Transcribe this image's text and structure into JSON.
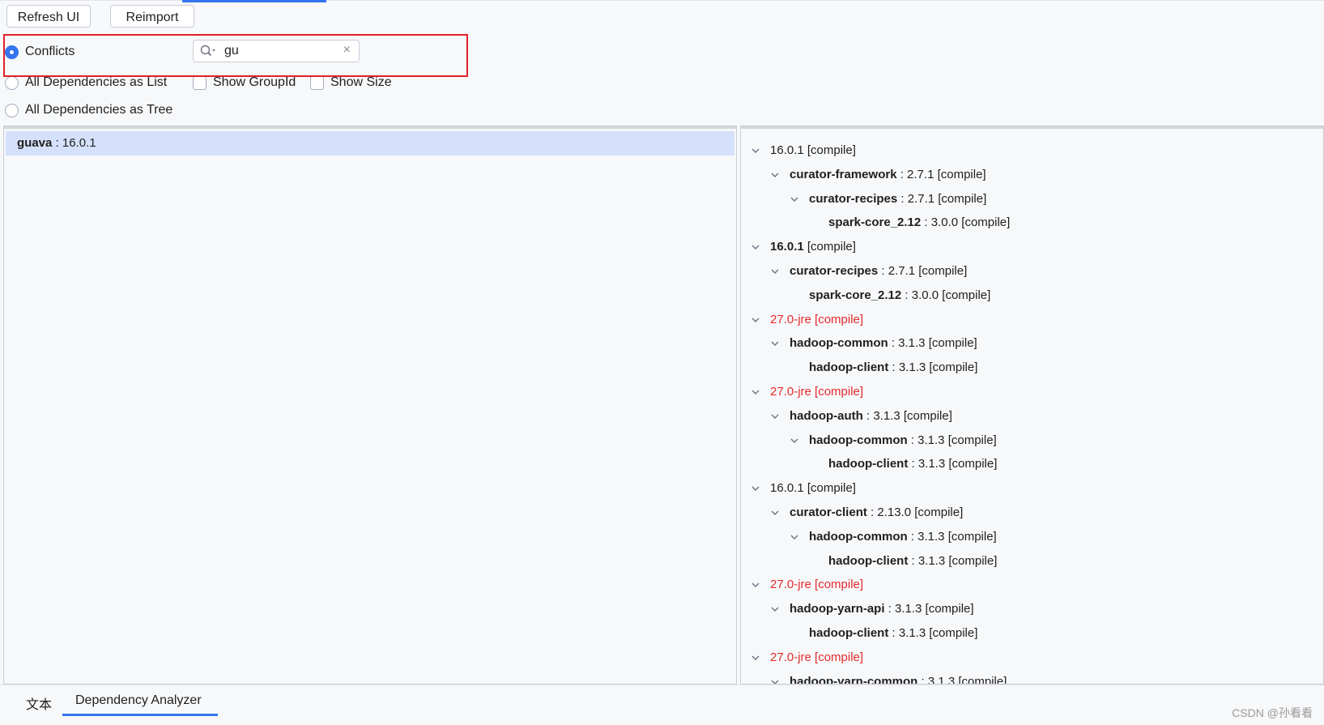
{
  "toolbar": {
    "refresh_label": "Refresh UI",
    "reimport_label": "Reimport"
  },
  "view_options": {
    "conflicts_label": "Conflicts",
    "list_label": "All Dependencies as List",
    "tree_label": "All Dependencies as Tree",
    "show_groupid_label": "Show GroupId",
    "show_size_label": "Show Size",
    "selected": "Conflicts"
  },
  "search": {
    "value": "gu",
    "clear_glyph": "×",
    "icon": "search-icon"
  },
  "left_list": {
    "items": [
      {
        "name": "guava",
        "version": " : 16.0.1",
        "selected": true
      }
    ]
  },
  "tree": {
    "rows": [
      {
        "level": 0,
        "expanded": true,
        "bold": "",
        "text": "16.0.1 [compile]",
        "conflict": false
      },
      {
        "level": 1,
        "expanded": true,
        "bold": "curator-framework",
        "text": " : 2.7.1 [compile]",
        "conflict": false
      },
      {
        "level": 2,
        "expanded": true,
        "bold": "curator-recipes",
        "text": " : 2.7.1 [compile]",
        "conflict": false
      },
      {
        "level": 3,
        "expanded": false,
        "bold": "spark-core_2.12",
        "text": " : 3.0.0 [compile]",
        "conflict": false
      },
      {
        "level": 0,
        "expanded": true,
        "bold": "16.0.1",
        "text": " [compile]",
        "conflict": false
      },
      {
        "level": 1,
        "expanded": true,
        "bold": "curator-recipes",
        "text": " : 2.7.1 [compile]",
        "conflict": false
      },
      {
        "level": 2,
        "expanded": false,
        "bold": "spark-core_2.12",
        "text": " : 3.0.0 [compile]",
        "conflict": false
      },
      {
        "level": 0,
        "expanded": true,
        "bold": "",
        "text": "27.0-jre [compile]",
        "conflict": true
      },
      {
        "level": 1,
        "expanded": true,
        "bold": "hadoop-common",
        "text": " : 3.1.3 [compile]",
        "conflict": false
      },
      {
        "level": 2,
        "expanded": false,
        "bold": "hadoop-client",
        "text": " : 3.1.3 [compile]",
        "conflict": false
      },
      {
        "level": 0,
        "expanded": true,
        "bold": "",
        "text": "27.0-jre [compile]",
        "conflict": true
      },
      {
        "level": 1,
        "expanded": true,
        "bold": "hadoop-auth",
        "text": " : 3.1.3 [compile]",
        "conflict": false
      },
      {
        "level": 2,
        "expanded": true,
        "bold": "hadoop-common",
        "text": " : 3.1.3 [compile]",
        "conflict": false
      },
      {
        "level": 3,
        "expanded": false,
        "bold": "hadoop-client",
        "text": " : 3.1.3 [compile]",
        "conflict": false
      },
      {
        "level": 0,
        "expanded": true,
        "bold": "",
        "text": "16.0.1 [compile]",
        "conflict": false
      },
      {
        "level": 1,
        "expanded": true,
        "bold": "curator-client",
        "text": " : 2.13.0 [compile]",
        "conflict": false
      },
      {
        "level": 2,
        "expanded": true,
        "bold": "hadoop-common",
        "text": " : 3.1.3 [compile]",
        "conflict": false
      },
      {
        "level": 3,
        "expanded": false,
        "bold": "hadoop-client",
        "text": " : 3.1.3 [compile]",
        "conflict": false
      },
      {
        "level": 0,
        "expanded": true,
        "bold": "",
        "text": "27.0-jre [compile]",
        "conflict": true
      },
      {
        "level": 1,
        "expanded": true,
        "bold": "hadoop-yarn-api",
        "text": " : 3.1.3 [compile]",
        "conflict": false
      },
      {
        "level": 2,
        "expanded": false,
        "bold": "hadoop-client",
        "text": " : 3.1.3 [compile]",
        "conflict": false
      },
      {
        "level": 0,
        "expanded": true,
        "bold": "",
        "text": "27.0-jre [compile]",
        "conflict": true
      },
      {
        "level": 1,
        "expanded": true,
        "bold": "hadoop-yarn-common",
        "text": " : 3.1.3 [compile]",
        "conflict": false
      }
    ]
  },
  "bottom_tabs": {
    "text_tab": "文本",
    "analyzer_tab": "Dependency Analyzer",
    "active": "Dependency Analyzer"
  },
  "watermark": "CSDN @孙看看",
  "colors": {
    "accent": "#3574f0",
    "conflict": "#e32b2b",
    "highlight_box": "#e0202a",
    "selection": "#d5e1fb"
  }
}
